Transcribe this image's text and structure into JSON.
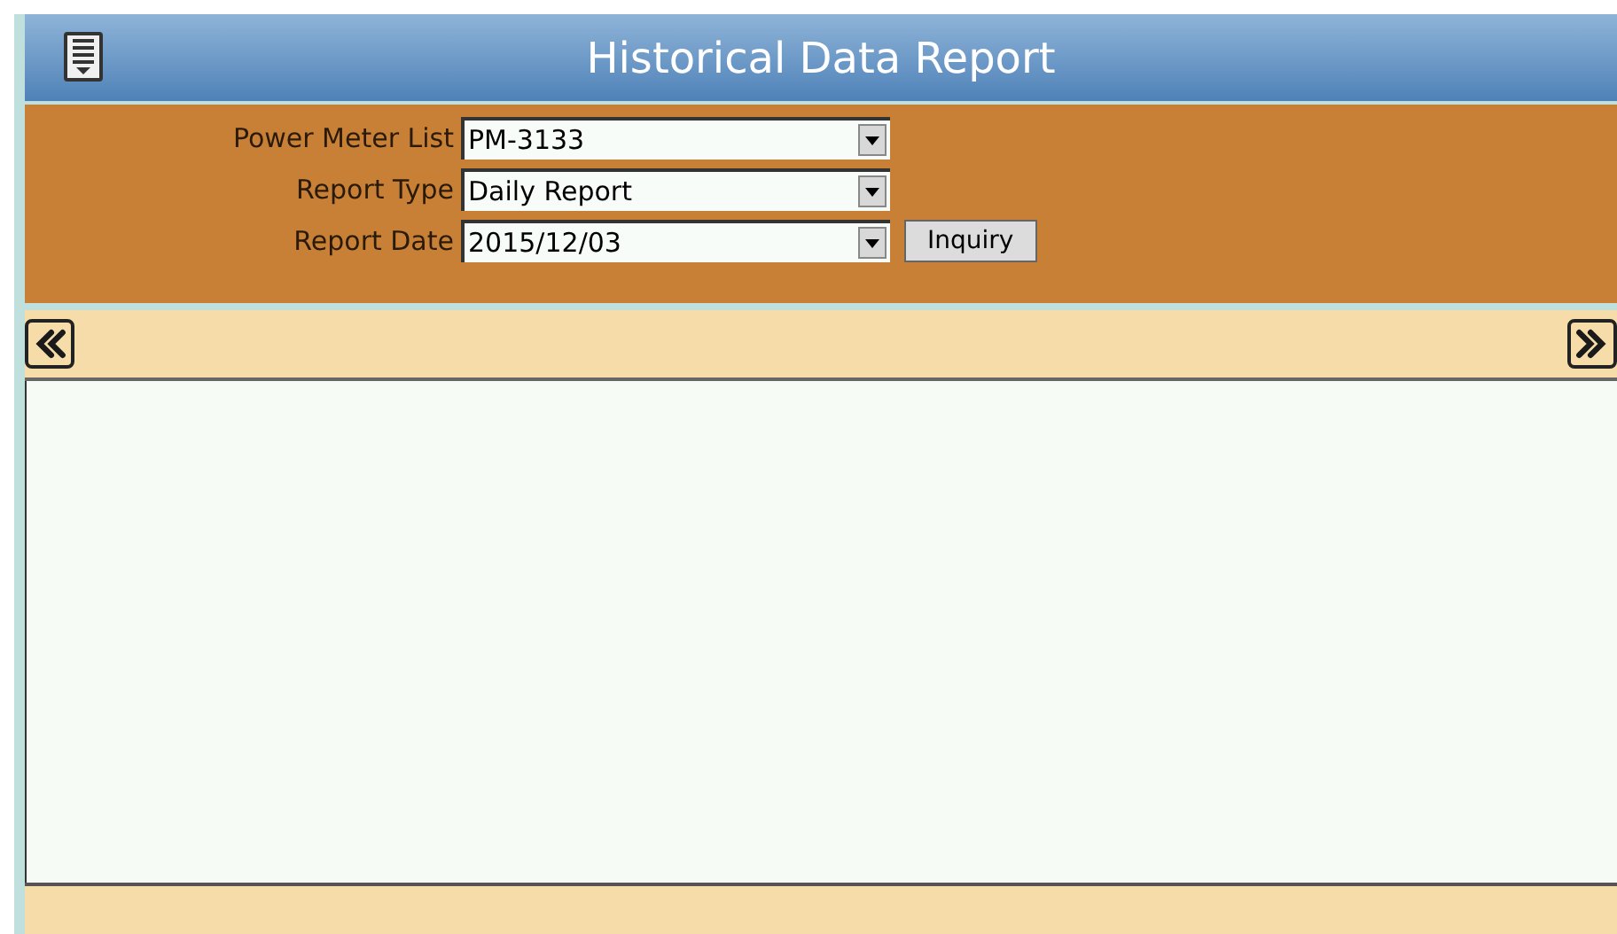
{
  "header": {
    "title": "Historical Data Report"
  },
  "form": {
    "fields": [
      {
        "label": "Power Meter List",
        "value": "PM-3133"
      },
      {
        "label": "Report Type",
        "value": "Daily Report"
      },
      {
        "label": "Report Date",
        "value": "2015/12/03"
      }
    ],
    "button": "Inquiry"
  }
}
